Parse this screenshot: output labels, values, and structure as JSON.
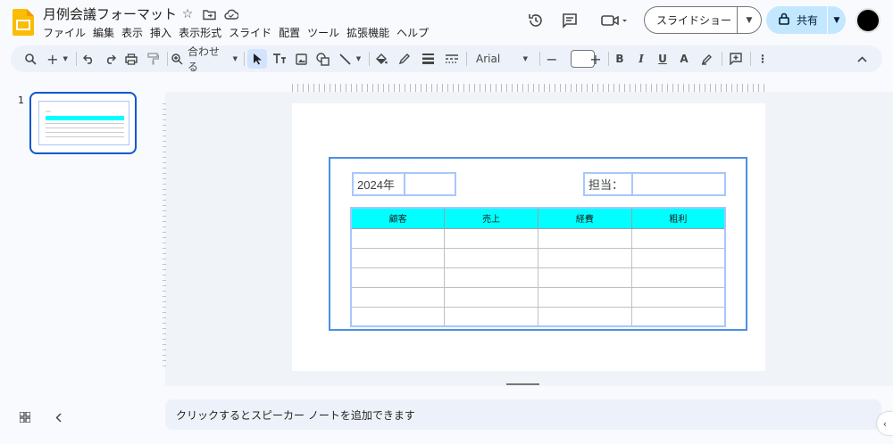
{
  "doc": {
    "title": "月例会議フォーマット",
    "brand_color": "#fbbc04"
  },
  "menu": [
    "ファイル",
    "編集",
    "表示",
    "挿入",
    "表示形式",
    "スライド",
    "配置",
    "ツール",
    "拡張機能",
    "ヘルプ"
  ],
  "header": {
    "slideshow_label": "スライドショー",
    "share_label": "共有"
  },
  "toolbar": {
    "zoom_label": "合わせる",
    "font_name": "Arial",
    "font_size": ""
  },
  "filmstrip": {
    "slide_number": "1"
  },
  "slide": {
    "year_label": "2024年",
    "year_value": "",
    "person_label": "担当：",
    "person_value": "",
    "table": {
      "headers": [
        "顧客",
        "売上",
        "経費",
        "粗利"
      ],
      "rows": [
        [
          "",
          "",
          "",
          ""
        ],
        [
          "",
          "",
          "",
          ""
        ],
        [
          "",
          "",
          "",
          ""
        ],
        [
          "",
          "",
          "",
          ""
        ],
        [
          "",
          "",
          "",
          ""
        ]
      ],
      "header_color": "#00ffff"
    }
  },
  "notes": {
    "placeholder": "クリックするとスピーカー ノートを追加できます"
  }
}
